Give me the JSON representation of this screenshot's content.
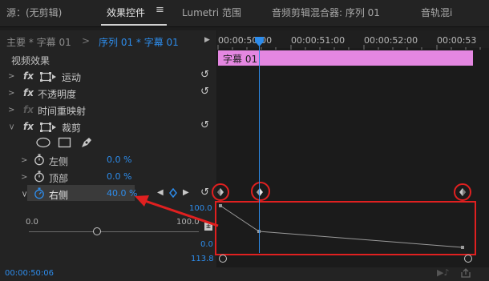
{
  "tabs": [
    {
      "label": "源：(无剪辑)"
    },
    {
      "label": "效果控件"
    },
    {
      "label": "Lumetri 范围"
    },
    {
      "label": "音频剪辑混合器: 序列 01"
    },
    {
      "label": "音轨混i"
    }
  ],
  "tab_menu_glyph": "≡",
  "header": {
    "master": "主要 * 字幕 01",
    "sequence": "序列 01 * 字幕 01",
    "play_glyph": "▶"
  },
  "section_title": "视频效果",
  "effects": {
    "motion": "运动",
    "opacity": "不透明度",
    "time_remap": "时间重映射",
    "crop": "裁剪"
  },
  "properties": {
    "left": {
      "label": "左侧",
      "value": "0.0 %"
    },
    "top": {
      "label": "顶部",
      "value": "0.0 %"
    },
    "right": {
      "label": "右侧",
      "value": "40.0 %"
    }
  },
  "slider": {
    "min": "0.0",
    "max": "100.0",
    "level": 0.4
  },
  "fx_label": "fx",
  "timeline": {
    "timecodes": [
      "00:00:50:00",
      "00:00:51:00",
      "00:00:52:00",
      "00:00:53"
    ],
    "clip_label": "字幕 01",
    "graph_top": "100.0",
    "graph_bottom": "0.0",
    "graph_value": "113.8"
  },
  "status": {
    "timecode": "00:00:50:06"
  },
  "colors": {
    "accent": "#2d8ceb",
    "clip": "#e487e1",
    "highlight": "#e02020"
  }
}
